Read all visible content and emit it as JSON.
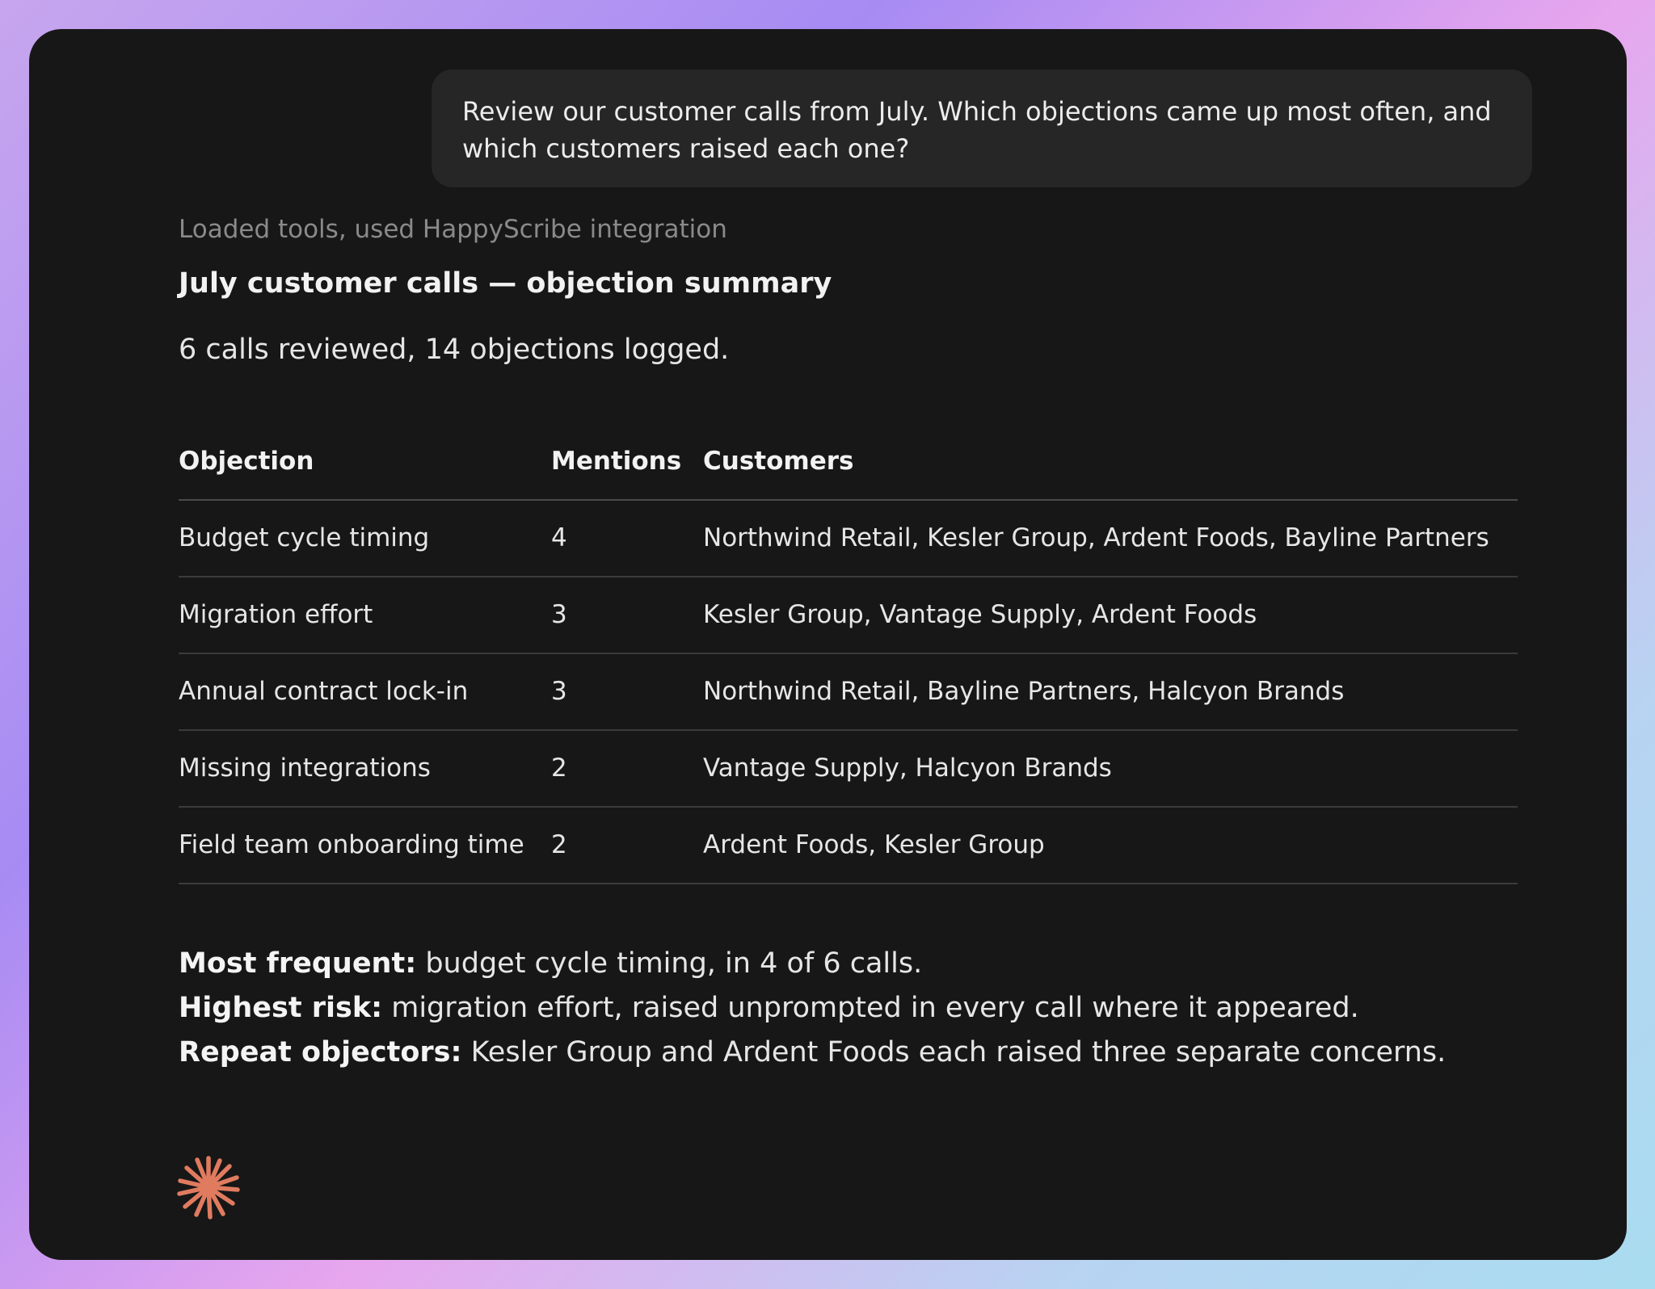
{
  "user_message": "Review our customer calls from July. Which objections came up most often, and which customers raised each one?",
  "tool_status": "Loaded tools, used HappyScribe integration",
  "title": "July customer calls — objection summary",
  "summary": "6 calls reviewed, 14 objections logged.",
  "table": {
    "headers": [
      "Objection",
      "Mentions",
      "Customers"
    ],
    "rows": [
      {
        "objection": "Budget cycle timing",
        "mentions": "4",
        "customers": "Northwind Retail, Kesler Group, Ardent Foods, Bayline Partners"
      },
      {
        "objection": "Migration effort",
        "mentions": "3",
        "customers": "Kesler Group, Vantage Supply, Ardent Foods"
      },
      {
        "objection": "Annual contract lock-in",
        "mentions": "3",
        "customers": "Northwind Retail, Bayline Partners, Halcyon Brands"
      },
      {
        "objection": "Missing integrations",
        "mentions": "2",
        "customers": "Vantage Supply, Halcyon Brands"
      },
      {
        "objection": "Field team onboarding time",
        "mentions": "2",
        "customers": "Ardent Foods, Kesler Group"
      }
    ]
  },
  "notes": [
    {
      "label": "Most frequent:",
      "text": " budget cycle timing, in 4 of 6 calls."
    },
    {
      "label": "Highest risk:",
      "text": " migration effort, raised unprompted in every call where it appeared."
    },
    {
      "label": "Repeat objectors:",
      "text": " Kesler Group and Ardent Foods each raised three separate concerns."
    }
  ],
  "icons": {
    "assistant_logo": "sparkle-burst-icon"
  },
  "colors": {
    "accent": "#e07b5f",
    "background": "#171717",
    "bubble": "#262626"
  }
}
